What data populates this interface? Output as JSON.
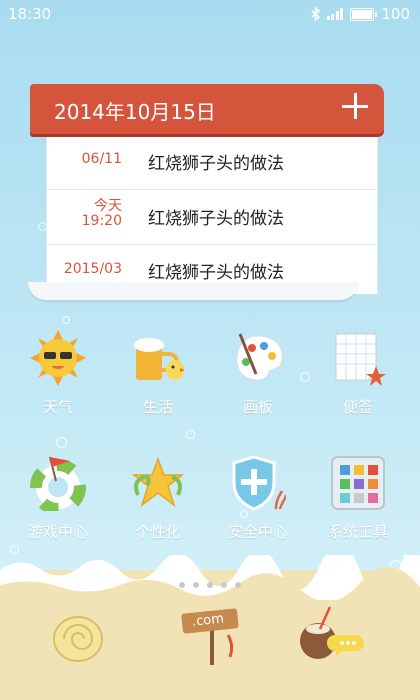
{
  "status": {
    "time": "18:30",
    "battery": "100"
  },
  "calendar": {
    "date": "2014年10月15日",
    "add_label": "+",
    "items": [
      {
        "date": "06/11",
        "title": "红烧狮子头的做法"
      },
      {
        "date": "今天\n19:20",
        "title": "红烧狮子头的做法"
      },
      {
        "date": "2015/03",
        "title": "红烧狮子头的做法"
      }
    ]
  },
  "apps": [
    {
      "label": "天气",
      "icon": "sun-icon"
    },
    {
      "label": "生活",
      "icon": "beer-icon"
    },
    {
      "label": "画板",
      "icon": "palette-icon"
    },
    {
      "label": "便签",
      "icon": "note-icon"
    },
    {
      "label": "游戏中心",
      "icon": "lifebuoy-icon"
    },
    {
      "label": "个性化",
      "icon": "starfish-icon"
    },
    {
      "label": "安全中心",
      "icon": "shield-icon"
    },
    {
      "label": "系统工具",
      "icon": "toolbox-icon"
    }
  ],
  "dock": [
    {
      "icon": "shell-icon"
    },
    {
      "icon": "com-sign-icon",
      "text": ".com"
    },
    {
      "icon": "coconut-icon"
    }
  ],
  "colors": {
    "accent": "#d5553c",
    "sky": "#bde6f4",
    "sand": "#f2e3b6"
  }
}
